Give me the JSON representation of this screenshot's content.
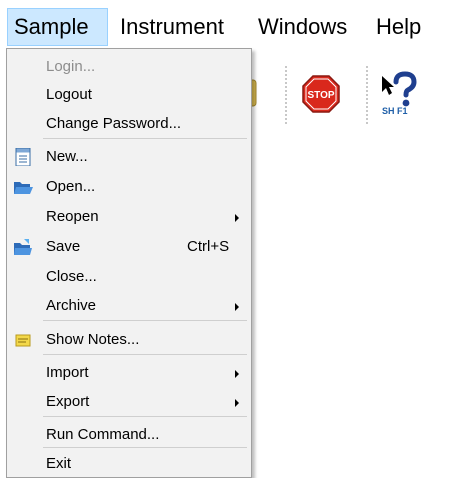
{
  "menubar": {
    "items": [
      {
        "label": "Sample"
      },
      {
        "label": "Instrument"
      },
      {
        "label": "Windows"
      },
      {
        "label": "Help"
      }
    ]
  },
  "toolbar": {
    "stop_icon_text": "STOP",
    "help_icon_text": "SH  F1"
  },
  "dropdown": {
    "items": [
      {
        "label": "Login..."
      },
      {
        "label": "Logout"
      },
      {
        "label": "Change Password..."
      },
      {
        "label": "New..."
      },
      {
        "label": "Open..."
      },
      {
        "label": "Reopen"
      },
      {
        "label": "Save",
        "shortcut": "Ctrl+S"
      },
      {
        "label": "Close..."
      },
      {
        "label": "Archive"
      },
      {
        "label": "Show Notes..."
      },
      {
        "label": "Import"
      },
      {
        "label": "Export"
      },
      {
        "label": "Run Command..."
      },
      {
        "label": "Exit"
      }
    ]
  },
  "colors": {
    "menubar_open_bg": "#cce8ff",
    "menubar_open_border": "#99d1ff",
    "dropdown_bg": "#f2f2f2",
    "disabled_text": "#8d8d8d",
    "stop_red": "#d9281c"
  }
}
